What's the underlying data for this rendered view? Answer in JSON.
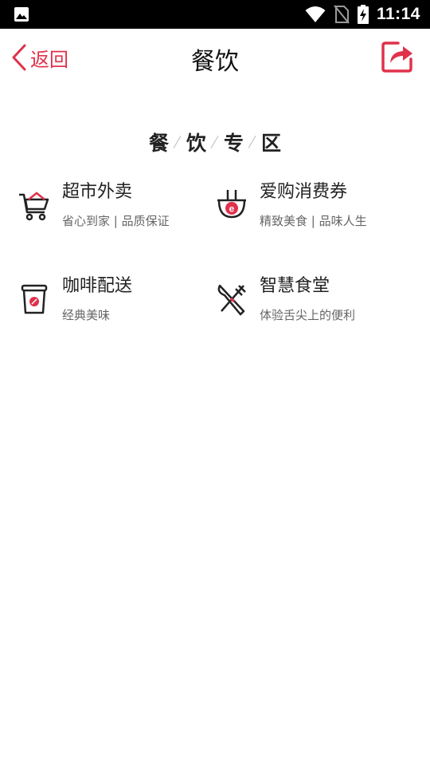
{
  "status_bar": {
    "time": "11:14",
    "icons": [
      "image-icon",
      "wifi-icon",
      "no-sim-icon",
      "battery-charging-icon"
    ]
  },
  "nav": {
    "back_label": "返回",
    "title": "餐饮",
    "share_icon": "share-icon"
  },
  "section": {
    "chars": [
      "餐",
      "饮",
      "专",
      "区"
    ]
  },
  "colors": {
    "accent": "#e0314b",
    "text": "#222222",
    "subtext": "#666666"
  },
  "services": [
    {
      "name": "超市外卖",
      "desc": "省心到家 | 品质保证",
      "icon": "shopping-cart-icon"
    },
    {
      "name": "爱购消费券",
      "desc": "精致美食 | 品味人生",
      "icon": "bowl-e-icon"
    },
    {
      "name": "咖啡配送",
      "desc": "经典美味",
      "icon": "coffee-cup-icon"
    },
    {
      "name": "智慧食堂",
      "desc": "体验舌尖上的便利",
      "icon": "knife-fork-icon"
    }
  ]
}
